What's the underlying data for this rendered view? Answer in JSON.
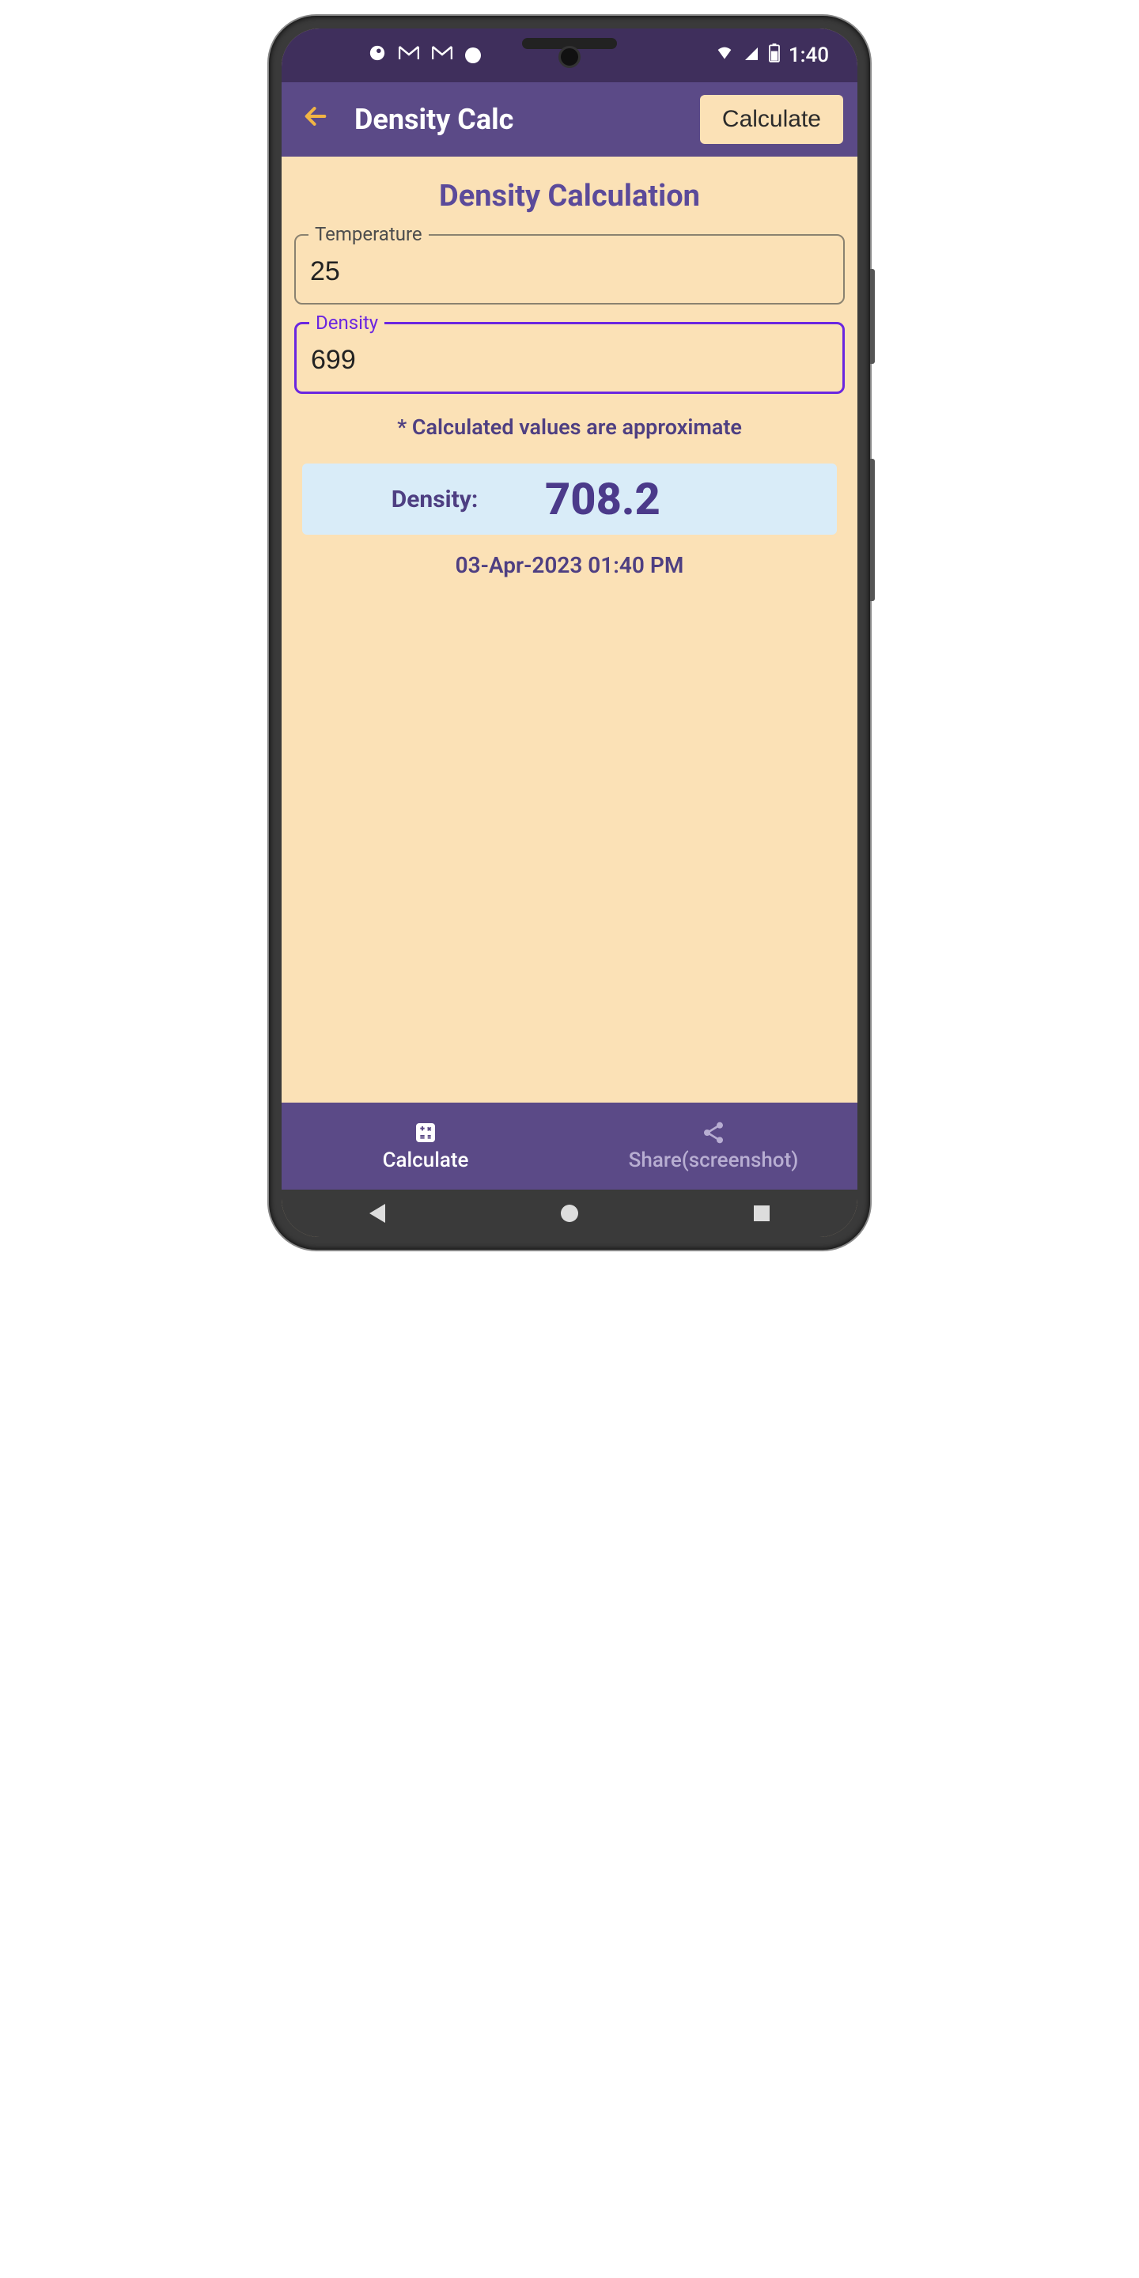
{
  "statusbar": {
    "time": "1:40"
  },
  "appbar": {
    "title": "Density Calc",
    "calculate_label": "Calculate"
  },
  "page": {
    "heading": "Density Calculation",
    "temperature_label": "Temperature",
    "temperature_value": "25",
    "density_label": "Density",
    "density_value": "699",
    "note": "* Calculated values are approximate",
    "result_label": "Density:",
    "result_value": "708.2",
    "timestamp": "03-Apr-2023 01:40 PM"
  },
  "bottomnav": {
    "calculate_label": "Calculate",
    "share_label": "Share(screenshot)"
  }
}
